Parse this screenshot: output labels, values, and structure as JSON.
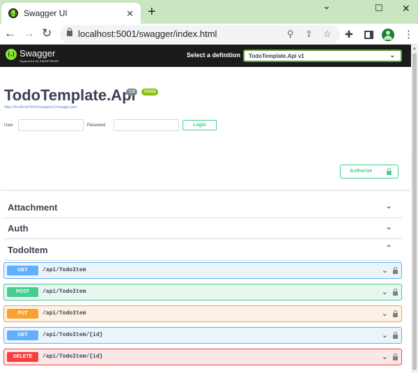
{
  "browser": {
    "tab_title": "Swagger UI",
    "url": "localhost:5001/swagger/index.html",
    "icons": [
      "close-icon",
      "plus-icon",
      "minimize-icon",
      "maximize-icon",
      "back-icon",
      "forward-icon",
      "reload-icon",
      "lock-icon",
      "zoom-icon",
      "share-icon",
      "star-icon",
      "extensions-icon",
      "side-panel-icon",
      "profile-icon",
      "menu-icon"
    ]
  },
  "topbar": {
    "logo_text": "Swagger",
    "logo_sub": "Supported by SMARTBEAR",
    "definition_label": "Select a definition",
    "definition_value": "TodoTemplate.Api v1"
  },
  "info": {
    "title": "TodoTemplate.Api",
    "version": "1.0",
    "oas": "OAS3",
    "spec_url": "https://localhost:5001/swagger/v1/swagger.json",
    "user_label": "User",
    "password_label": "Password",
    "login_label": "Login"
  },
  "scheme": {
    "authorize_label": "Authorize"
  },
  "tags": [
    {
      "name": "Attachment",
      "expanded": false
    },
    {
      "name": "Auth",
      "expanded": false
    },
    {
      "name": "TodoItem",
      "expanded": true
    }
  ],
  "operations": [
    {
      "method": "GET",
      "path": "/api/TodoItem"
    },
    {
      "method": "POST",
      "path": "/api/TodoItem"
    },
    {
      "method": "PUT",
      "path": "/api/TodoItem"
    },
    {
      "method": "GET",
      "path": "/api/TodoItem/{id}"
    },
    {
      "method": "DELETE",
      "path": "/api/TodoItem/{id}"
    }
  ],
  "colors": {
    "get": "#61affe",
    "post": "#49cc90",
    "put": "#fca130",
    "delete": "#f93e3e",
    "swagger_green": "#85ea2d",
    "chrome_tabstrip": "#c8e6c0"
  }
}
